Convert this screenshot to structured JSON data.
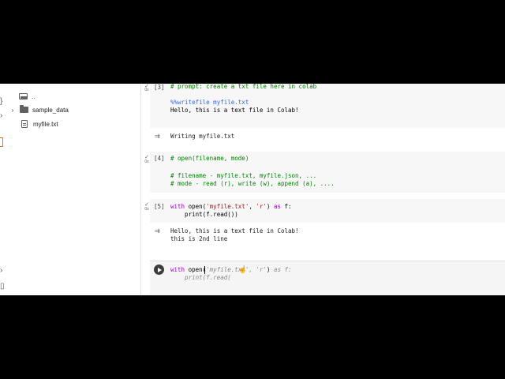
{
  "sidebar": {
    "parent_label": "..",
    "items": [
      {
        "label": "sample_data",
        "type": "folder"
      },
      {
        "label": "myfile.txt",
        "type": "file"
      }
    ]
  },
  "cells": [
    {
      "exec_count": "[3]",
      "status_time": "0s",
      "lines": [
        "# prompt: create a txt file here in colab",
        "",
        "%%writefile myfile.txt",
        "Hello, this is a text file in Colab!"
      ],
      "output": [
        "Writing myfile.txt"
      ]
    },
    {
      "exec_count": "[4]",
      "status_time": "0s",
      "lines": [
        "# open(filename, mode)",
        "",
        "# filename - myfile.txt, myfile.json, ...",
        "# mode - read (r), write (w), append (a), ...."
      ]
    },
    {
      "exec_count": "[5]",
      "status_time": "0s",
      "line1": {
        "kw": "with",
        "fn": " open(",
        "arg1": "'myfile.txt'",
        "sep": ", ",
        "arg2": "'r'",
        "end": ") ",
        "as": "as",
        "var": " f:"
      },
      "line2": "    print(f.read())",
      "output": [
        "Hello, this is a text file in Colab!",
        "this is 2nd line"
      ]
    },
    {
      "line1": {
        "kw": "with",
        "fn": " open(",
        "hint_arg": "myfile.txt",
        "hint_sep": "', 'r'",
        "close": ")",
        "as_hint": " as f:"
      },
      "line2_hint": "    print(f.read("
    }
  ]
}
